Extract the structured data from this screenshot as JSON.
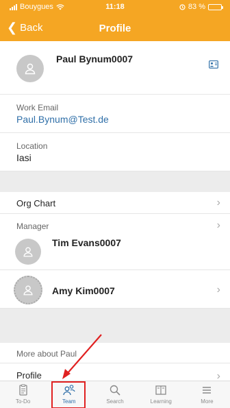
{
  "status": {
    "carrier": "Bouygues",
    "time": "11:18",
    "battery": "83 %",
    "battery_level": 0.83
  },
  "nav": {
    "back_label": "Back",
    "title": "Profile"
  },
  "profile": {
    "name": "Paul Bynum0007",
    "action_icon": "add-contact-icon"
  },
  "work_email": {
    "label": "Work Email",
    "value": "Paul.Bynum@Test.de"
  },
  "location": {
    "label": "Location",
    "value": "Iasi"
  },
  "org_chart": {
    "label": "Org Chart"
  },
  "manager": {
    "label": "Manager",
    "name": "Tim Evans0007"
  },
  "peer": {
    "name": "Amy Kim0007"
  },
  "more": {
    "label": "More about Paul",
    "profile_label": "Profile"
  },
  "tabs": [
    {
      "label": "To-Do",
      "icon": "todo-icon"
    },
    {
      "label": "Team",
      "icon": "team-icon",
      "active": true
    },
    {
      "label": "Search",
      "icon": "search-icon"
    },
    {
      "label": "Learning",
      "icon": "book-icon"
    },
    {
      "label": "More",
      "icon": "menu-icon"
    }
  ],
  "colors": {
    "brand": "#f5a623",
    "link": "#2f6fa8",
    "highlight": "#e02020"
  }
}
